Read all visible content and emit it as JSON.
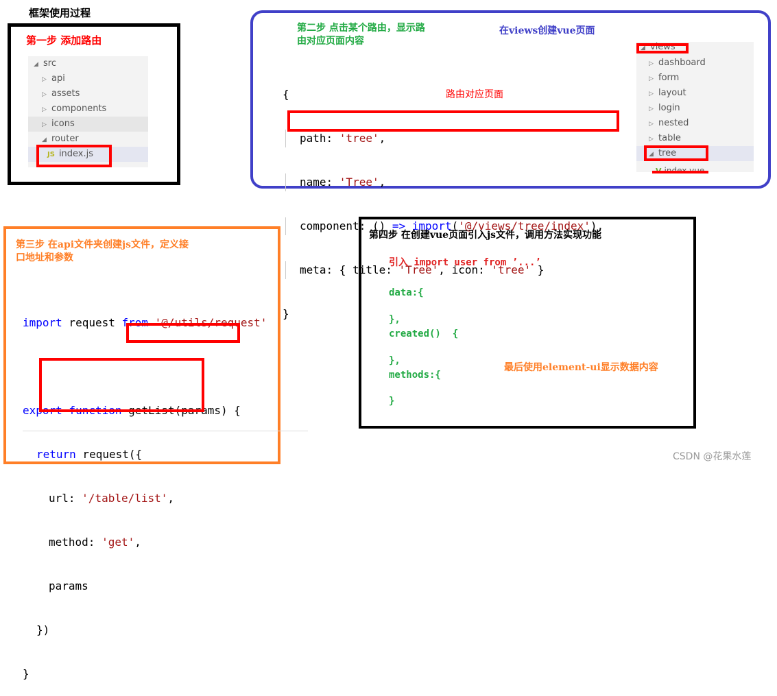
{
  "title": "框架使用过程",
  "step1": {
    "heading": "第一步  添加路由",
    "tree": [
      "src",
      "api",
      "assets",
      "components",
      "icons",
      "router",
      "index.js"
    ],
    "file_badge": "JS"
  },
  "step2": {
    "heading_line1": "第二步  点击某个路由，显示路",
    "heading_line2": "由对应页面内容",
    "note_views": "在views创建vue页面",
    "note_route": "路由对应页面",
    "code": {
      "open": "{",
      "path_key": "path: ",
      "path_val": "'tree'",
      "comma": ",",
      "name_key": "name: ",
      "name_val": "'Tree'",
      "comp_key": "component: () ",
      "arrow": "=>",
      "import_kw": " import",
      "comp_paren": "(",
      "comp_val": "'@/views/tree/index'",
      "comp_end": "),",
      "meta_key": "meta: { title: ",
      "meta_title": "'Tree'",
      "meta_mid": ", icon: ",
      "meta_icon": "'tree'",
      "meta_end": " }",
      "close": "}"
    },
    "tree": [
      "views",
      "dashboard",
      "form",
      "layout",
      "login",
      "nested",
      "table",
      "tree",
      "index.vue"
    ]
  },
  "step3": {
    "heading_line1": "第三步  在api文件夹创建js文件，定义接",
    "heading_line2": "口地址和参数",
    "code": {
      "import": "import",
      "req": " request ",
      "from": "from",
      "req_path": " '@/utils/request'",
      "export": "export",
      "function": " function",
      "fn": "getList(params)",
      "brace": " {",
      "return": "return",
      "request_call": " request({",
      "url_key": "url: ",
      "url_val": "'/table/list'",
      "method_key": "method: ",
      "method_val": "'get'",
      "params": "params",
      "close1": "})",
      "close2": "}"
    }
  },
  "step4": {
    "heading": "第四步  在创建vue页面引入js文件，调用方法实现功能",
    "import_line": "引入 import user from ’...’",
    "lines": [
      "data:{",
      "},",
      "created()  {",
      "},",
      "methods:{",
      "}"
    ],
    "final_note": "最后使用element-ui显示数据内容"
  },
  "watermark": "CSDN @花果水莲",
  "colors": {
    "step1": "#000000",
    "step2": "#4040c8",
    "step3": "#ff7f27",
    "step4": "#000000",
    "highlight": "#ff0000"
  }
}
